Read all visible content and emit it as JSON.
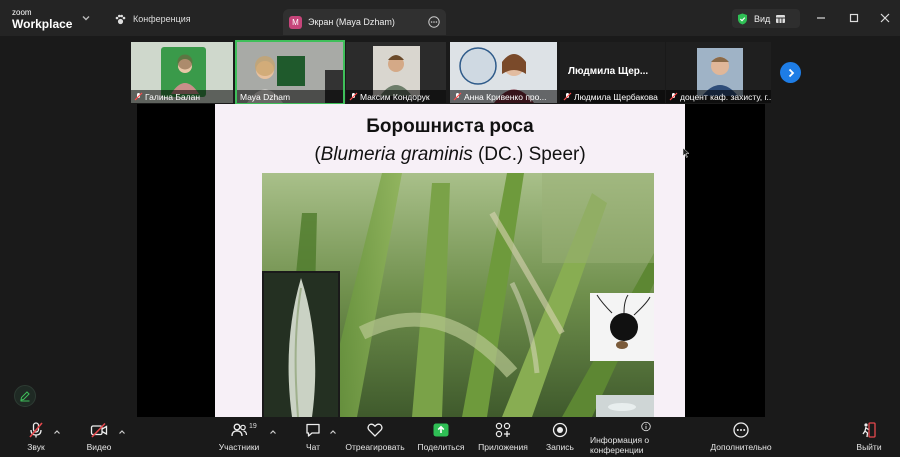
{
  "app": {
    "brand_top": "zoom",
    "brand_bottom": "Workplace"
  },
  "titlebar": {
    "conference_label": "Конференция",
    "share_tab_avatar": "M",
    "share_tab_label": "Экран (Maya Dzham)",
    "view_label": "Вид"
  },
  "gallery": {
    "tiles": [
      {
        "name": "Галина Балан"
      },
      {
        "name": "Maya Dzham"
      },
      {
        "name": "Максим Кондорук"
      },
      {
        "name": "Анна Кривенко про..."
      },
      {
        "name": "Людмила Щербакова",
        "display": "Людмила  Щер..."
      },
      {
        "name": "доцент  каф. захисту, г..."
      }
    ]
  },
  "slide": {
    "title": "Борошниста роса",
    "subtitle_open": "(",
    "subtitle_species": "Blumeria graminis",
    "subtitle_rest": "  (DC.) Speer)"
  },
  "toolbar": {
    "audio": "Звук",
    "video": "Видео",
    "participants": "Участники",
    "participants_count": "19",
    "chat": "Чат",
    "react": "Отреагировать",
    "share": "Поделиться",
    "apps": "Приложения",
    "record": "Запись",
    "info": "Информация о конференции",
    "more": "Дополнительно",
    "leave": "Выйти"
  },
  "colors": {
    "active_speaker": "#3fbf5a",
    "share_green": "#2fbf55",
    "leave_red": "#e5484d",
    "accent_blue": "#1e7de6"
  }
}
